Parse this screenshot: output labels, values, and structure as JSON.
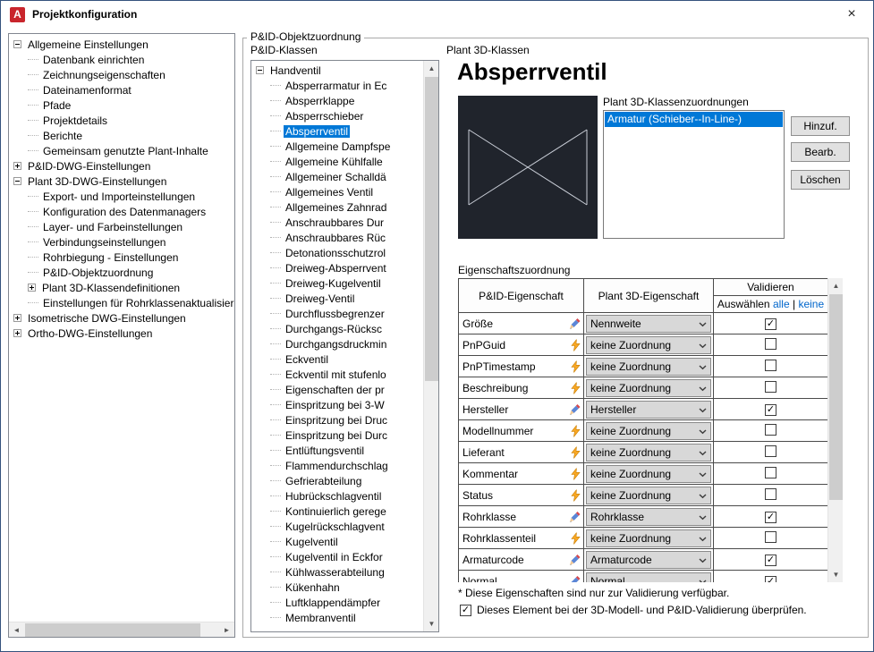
{
  "window": {
    "title": "Projektkonfiguration",
    "app_initial": "A",
    "close_glyph": "×"
  },
  "colors": {
    "selection": "#0078d7",
    "link": "#0066cc",
    "lightning": "#f9a825",
    "pencil_red": "#d6494e",
    "pencil_blue": "#5b86d6",
    "preview_bg": "#20242c",
    "brand_red": "#c9252c"
  },
  "scrollbar": {
    "up": "▲",
    "down": "▼",
    "left": "◄",
    "right": "►"
  },
  "glyphs": {
    "check": "✓"
  },
  "config_tree": {
    "items": [
      {
        "label": "Allgemeine Einstellungen",
        "level": 0,
        "toggle": "-"
      },
      {
        "label": "Datenbank einrichten",
        "level": 1,
        "toggle": ""
      },
      {
        "label": "Zeichnungseigenschaften",
        "level": 1,
        "toggle": ""
      },
      {
        "label": "Dateinamenformat",
        "level": 1,
        "toggle": ""
      },
      {
        "label": "Pfade",
        "level": 1,
        "toggle": ""
      },
      {
        "label": "Projektdetails",
        "level": 1,
        "toggle": ""
      },
      {
        "label": "Berichte",
        "level": 1,
        "toggle": ""
      },
      {
        "label": "Gemeinsam genutzte Plant-Inhalte",
        "level": 1,
        "toggle": ""
      },
      {
        "label": "P&ID-DWG-Einstellungen",
        "level": 0,
        "toggle": "+"
      },
      {
        "label": "Plant 3D-DWG-Einstellungen",
        "level": 0,
        "toggle": "-"
      },
      {
        "label": "Export- und Importeinstellungen",
        "level": 1,
        "toggle": ""
      },
      {
        "label": "Konfiguration des Datenmanagers",
        "level": 1,
        "toggle": ""
      },
      {
        "label": "Layer- und Farbeinstellungen",
        "level": 1,
        "toggle": ""
      },
      {
        "label": "Verbindungseinstellungen",
        "level": 1,
        "toggle": ""
      },
      {
        "label": "Rohrbiegung - Einstellungen",
        "level": 1,
        "toggle": ""
      },
      {
        "label": "P&ID-Objektzuordnung",
        "level": 1,
        "toggle": ""
      },
      {
        "label": "Plant 3D-Klassendefinitionen",
        "level": 1,
        "toggle": "+"
      },
      {
        "label": "Einstellungen für Rohrklassenaktualisierun",
        "level": 1,
        "toggle": ""
      },
      {
        "label": "Isometrische DWG-Einstellungen",
        "level": 0,
        "toggle": "+"
      },
      {
        "label": "Ortho-DWG-Einstellungen",
        "level": 0,
        "toggle": "+"
      }
    ]
  },
  "pid_tree": {
    "items": [
      {
        "label": "Handventil",
        "level": 0,
        "toggle": "-"
      },
      {
        "label": "Absperrarmatur in Ec",
        "level": 1,
        "toggle": ""
      },
      {
        "label": "Absperrklappe",
        "level": 1,
        "toggle": ""
      },
      {
        "label": "Absperrschieber",
        "level": 1,
        "toggle": ""
      },
      {
        "label": "Absperrventil",
        "level": 1,
        "toggle": "",
        "selected": true
      },
      {
        "label": "Allgemeine Dampfspe",
        "level": 1,
        "toggle": ""
      },
      {
        "label": "Allgemeine Kühlfalle",
        "level": 1,
        "toggle": ""
      },
      {
        "label": "Allgemeiner Schalldä",
        "level": 1,
        "toggle": ""
      },
      {
        "label": "Allgemeines Ventil",
        "level": 1,
        "toggle": ""
      },
      {
        "label": "Allgemeines Zahnrad",
        "level": 1,
        "toggle": ""
      },
      {
        "label": "Anschraubbares Dur",
        "level": 1,
        "toggle": ""
      },
      {
        "label": "Anschraubbares Rüc",
        "level": 1,
        "toggle": ""
      },
      {
        "label": "Detonationsschutzrol",
        "level": 1,
        "toggle": ""
      },
      {
        "label": "Dreiweg-Absperrvent",
        "level": 1,
        "toggle": ""
      },
      {
        "label": "Dreiweg-Kugelventil",
        "level": 1,
        "toggle": ""
      },
      {
        "label": "Dreiweg-Ventil",
        "level": 1,
        "toggle": ""
      },
      {
        "label": "Durchflussbegrenzer",
        "level": 1,
        "toggle": ""
      },
      {
        "label": "Durchgangs-Rücksc",
        "level": 1,
        "toggle": ""
      },
      {
        "label": "Durchgangsdruckmin",
        "level": 1,
        "toggle": ""
      },
      {
        "label": "Eckventil",
        "level": 1,
        "toggle": ""
      },
      {
        "label": "Eckventil mit stufenlo",
        "level": 1,
        "toggle": ""
      },
      {
        "label": "Eigenschaften der pr",
        "level": 1,
        "toggle": ""
      },
      {
        "label": "Einspritzung bei 3-W",
        "level": 1,
        "toggle": ""
      },
      {
        "label": "Einspritzung bei Druc",
        "level": 1,
        "toggle": ""
      },
      {
        "label": "Einspritzung bei Durc",
        "level": 1,
        "toggle": ""
      },
      {
        "label": "Entlüftungsventil",
        "level": 1,
        "toggle": ""
      },
      {
        "label": "Flammendurchschlag",
        "level": 1,
        "toggle": ""
      },
      {
        "label": "Gefrierabteilung",
        "level": 1,
        "toggle": ""
      },
      {
        "label": "Hubrückschlagventil",
        "level": 1,
        "toggle": ""
      },
      {
        "label": "Kontinuierlich gerege",
        "level": 1,
        "toggle": ""
      },
      {
        "label": "Kugelrückschlagvent",
        "level": 1,
        "toggle": ""
      },
      {
        "label": "Kugelventil",
        "level": 1,
        "toggle": ""
      },
      {
        "label": "Kugelventil in Eckfor",
        "level": 1,
        "toggle": ""
      },
      {
        "label": "Kühlwasserabteilung",
        "level": 1,
        "toggle": ""
      },
      {
        "label": "Kükenhahn",
        "level": 1,
        "toggle": ""
      },
      {
        "label": "Luftklappendämpfer",
        "level": 1,
        "toggle": ""
      },
      {
        "label": "Membranventil",
        "level": 1,
        "toggle": ""
      }
    ]
  },
  "main": {
    "group_label": "P&ID-Objektzuordnung",
    "pid_classes_label": "P&ID-Klassen",
    "plant3d_label": "Plant 3D-Klassen",
    "selected_class_heading": "Absperrventil",
    "assignments_label": "Plant 3D-Klassenzuordnungen",
    "assignment_items": [
      "Armatur (Schieber--In-Line-)"
    ],
    "buttons": {
      "add": "Hinzuf.",
      "edit": "Bearb.",
      "delete": "Löschen"
    },
    "mapping_label": "Eigenschaftszuordnung",
    "footnote": "* Diese Eigenschaften sind nur zur Validierung verfügbar.",
    "validate_checkbox_label": "Dieses Element bei der 3D-Modell- und P&ID-Validierung überprüfen.",
    "validate_checkbox_checked": true
  },
  "mapping_table": {
    "headers": {
      "col1": "P&ID-Eigenschaft",
      "col2": "Plant 3D-Eigenschaft",
      "validieren": "Validieren",
      "auswaehlen": "Auswählen",
      "link_alle": "alle",
      "link_sep": "|",
      "link_keine": "keine"
    },
    "rows": [
      {
        "pid": "Größe",
        "icon": "pencil",
        "plant": "Nennweite",
        "checked": true
      },
      {
        "pid": "PnPGuid",
        "icon": "lightning",
        "plant": "keine Zuordnung",
        "checked": false
      },
      {
        "pid": "PnPTimestamp",
        "icon": "lightning",
        "plant": "keine Zuordnung",
        "checked": false
      },
      {
        "pid": "Beschreibung",
        "icon": "lightning",
        "plant": "keine Zuordnung",
        "checked": false
      },
      {
        "pid": "Hersteller",
        "icon": "pencil",
        "plant": "Hersteller",
        "checked": true
      },
      {
        "pid": "Modellnummer",
        "icon": "lightning",
        "plant": "keine Zuordnung",
        "checked": false
      },
      {
        "pid": "Lieferant",
        "icon": "lightning",
        "plant": "keine Zuordnung",
        "checked": false
      },
      {
        "pid": "Kommentar",
        "icon": "lightning",
        "plant": "keine Zuordnung",
        "checked": false
      },
      {
        "pid": "Status",
        "icon": "lightning",
        "plant": "keine Zuordnung",
        "checked": false
      },
      {
        "pid": "Rohrklasse",
        "icon": "pencil",
        "plant": "Rohrklasse",
        "checked": true
      },
      {
        "pid": "Rohrklassenteil",
        "icon": "lightning",
        "plant": "keine Zuordnung",
        "checked": false
      },
      {
        "pid": "Armaturcode",
        "icon": "pencil",
        "plant": "Armaturcode",
        "checked": true
      },
      {
        "pid": "Normal",
        "icon": "pencil",
        "plant": "Normal",
        "checked": true
      }
    ]
  }
}
